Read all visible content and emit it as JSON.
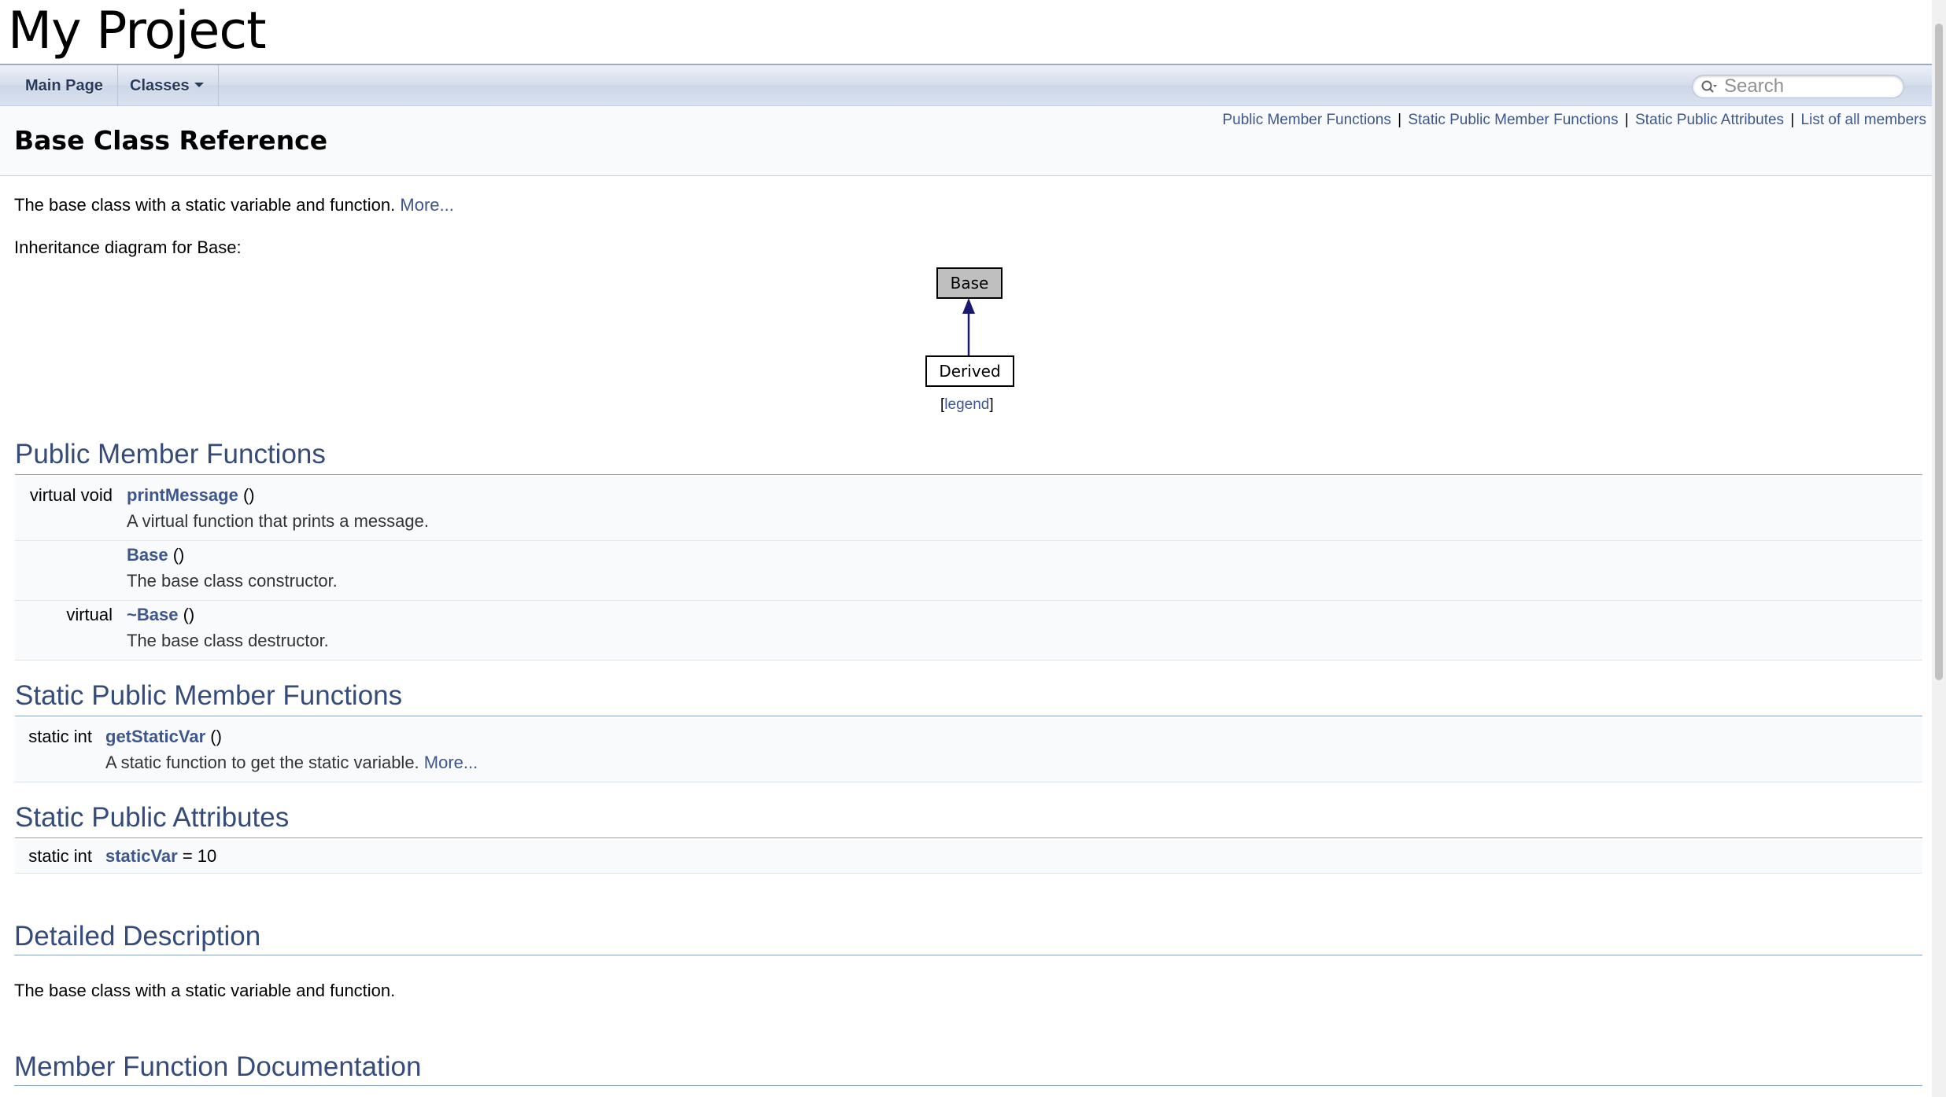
{
  "project": {
    "name": "My Project"
  },
  "nav": {
    "main_page": "Main Page",
    "classes": "Classes",
    "search_placeholder": "Search"
  },
  "summary": {
    "links": [
      "Public Member Functions",
      "Static Public Member Functions",
      "Static Public Attributes",
      "List of all members"
    ],
    "separator": "|"
  },
  "page": {
    "title": "Base Class Reference",
    "brief": "The base class with a static variable and function.",
    "more": "More...",
    "inheritance_label": "Inheritance diagram for Base:",
    "diagram": {
      "base": "Base",
      "derived": "Derived",
      "legend": "legend",
      "legend_open": "[",
      "legend_close": "]"
    }
  },
  "public_member_functions": {
    "heading": "Public Member Functions",
    "rows": [
      {
        "type": "virtual void",
        "name": "printMessage",
        "args": " ()",
        "desc": "A virtual function that prints a message."
      },
      {
        "type": "",
        "name": "Base",
        "args": " ()",
        "desc": "The base class constructor."
      },
      {
        "type": "virtual",
        "name": "~Base",
        "args": " ()",
        "desc": "The base class destructor."
      }
    ]
  },
  "static_public_member_functions": {
    "heading": "Static Public Member Functions",
    "rows": [
      {
        "type": "static int",
        "name": "getStaticVar",
        "args": " ()",
        "desc": "A static function to get the static variable.",
        "more": "More..."
      }
    ]
  },
  "static_public_attributes": {
    "heading": "Static Public Attributes",
    "rows": [
      {
        "type": "static int",
        "name": "staticVar",
        "value": " = 10"
      }
    ]
  },
  "detailed_description": {
    "heading": "Detailed Description",
    "text": "The base class with a static variable and function."
  },
  "member_function_documentation": {
    "heading": "Member Function Documentation"
  },
  "colors": {
    "link": "#3D578C",
    "heading": "#354C7B",
    "nav_text": "#283A5D",
    "base_node_fill": "#BFBFBF",
    "arrow": "#191970"
  }
}
